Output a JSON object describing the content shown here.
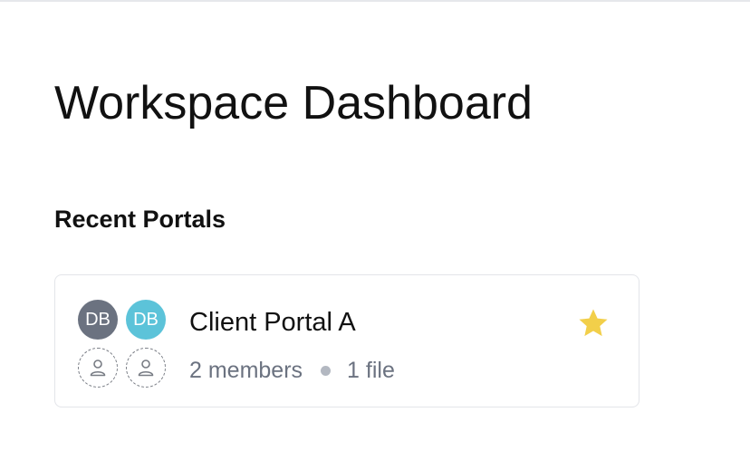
{
  "page": {
    "title": "Workspace Dashboard"
  },
  "recent_portals": {
    "heading": "Recent Portals",
    "items": [
      {
        "name": "Client Portal A",
        "members": "2 members",
        "files": "1 file",
        "starred": true,
        "avatars": [
          {
            "initials": "DB",
            "color": "#6b7280"
          },
          {
            "initials": "DB",
            "color": "#5cc3d9"
          },
          {
            "icon": "user-placeholder-icon"
          },
          {
            "icon": "user-placeholder-icon"
          }
        ]
      }
    ]
  },
  "colors": {
    "star": "#f2cf4a",
    "card_border": "#e3e5e9",
    "meta_text": "#6b7280"
  }
}
